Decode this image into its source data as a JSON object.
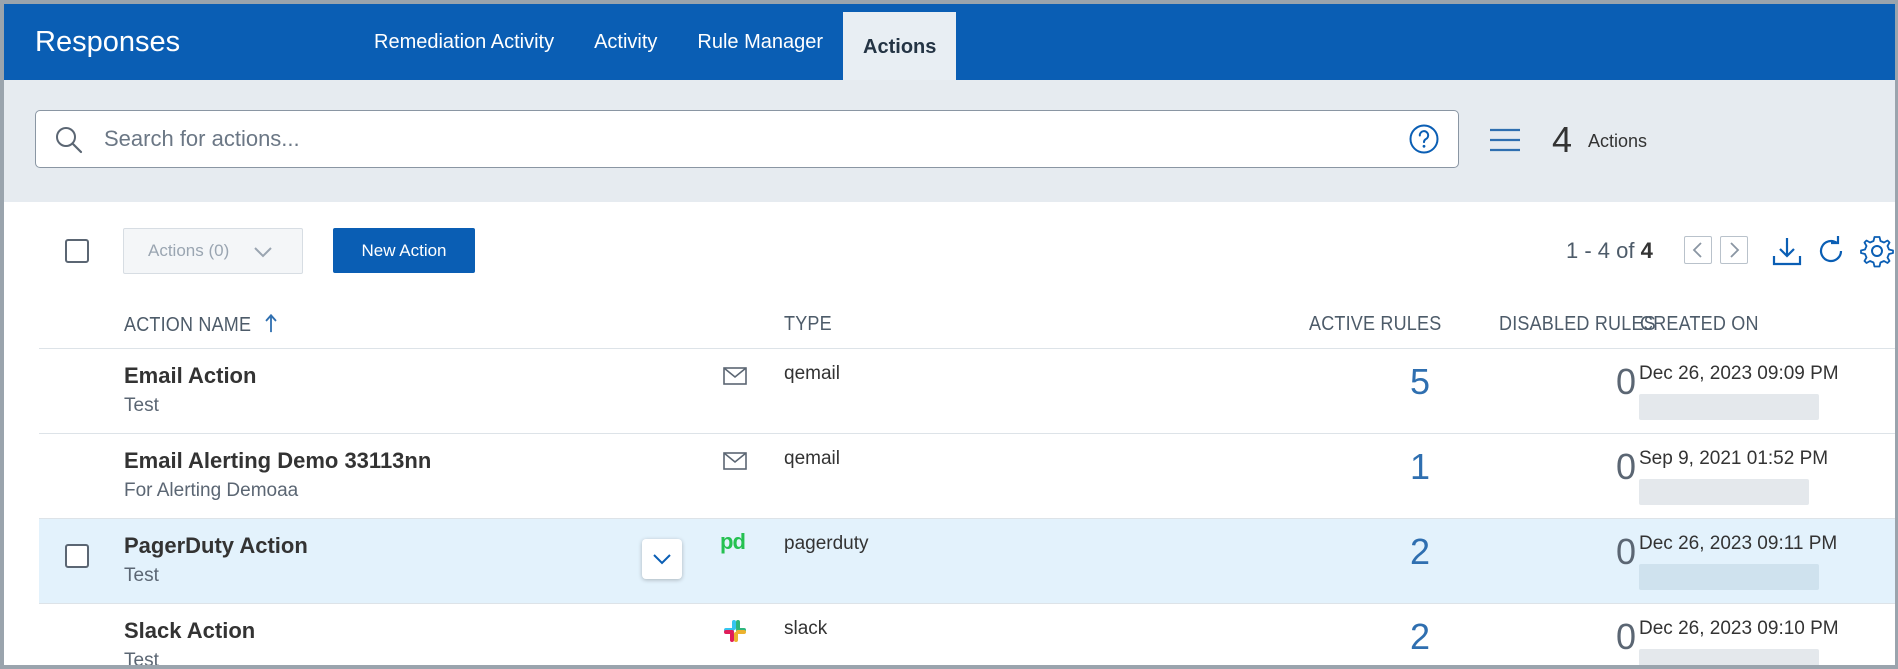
{
  "app": {
    "title": "Responses"
  },
  "nav": {
    "tabs": [
      {
        "label": "Remediation Activity",
        "active": false
      },
      {
        "label": "Activity",
        "active": false
      },
      {
        "label": "Rule Manager",
        "active": false
      },
      {
        "label": "Actions",
        "active": true
      }
    ]
  },
  "search": {
    "placeholder": "Search for actions...",
    "value": ""
  },
  "summary": {
    "count": "4",
    "label": "Actions"
  },
  "toolbar": {
    "actions_dropdown": "Actions (0)",
    "new_action": "New Action",
    "pager_range": "1 - 4 of",
    "pager_total": "4"
  },
  "table": {
    "columns": {
      "name": "ACTION NAME",
      "type": "TYPE",
      "active_rules": "ACTIVE RULES",
      "disabled_rules": "DISABLED RULES",
      "created_on": "CREATED ON"
    },
    "sort": {
      "column": "name",
      "direction": "ascending"
    },
    "rows": [
      {
        "name": "Email Action",
        "description": "Test",
        "type": "qemail",
        "type_icon": "mail-icon",
        "active_rules": "5",
        "disabled_rules": "0",
        "created_on": "Dec 26, 2023 09:09 PM"
      },
      {
        "name": "Email Alerting Demo 33113nn",
        "description": "For Alerting Demoaa",
        "type": "qemail",
        "type_icon": "mail-icon",
        "active_rules": "1",
        "disabled_rules": "0",
        "created_on": "Sep 9, 2021 01:52 PM"
      },
      {
        "name": "PagerDuty Action",
        "description": "Test",
        "type": "pagerduty",
        "type_icon": "pagerduty-logo",
        "type_icon_text": "pd",
        "active_rules": "2",
        "disabled_rules": "0",
        "created_on": "Dec 26, 2023 09:11 PM",
        "highlighted": true
      },
      {
        "name": "Slack Action",
        "description": "Test",
        "type": "slack",
        "type_icon": "slack-logo",
        "active_rules": "2",
        "disabled_rules": "0",
        "created_on": "Dec 26, 2023 09:10 PM"
      }
    ]
  },
  "colors": {
    "brand": "#0a5eb4",
    "active_tab_bg": "#e8eef3",
    "highlight_row": "#e3f2fc",
    "link_number": "#2f6fb0"
  }
}
